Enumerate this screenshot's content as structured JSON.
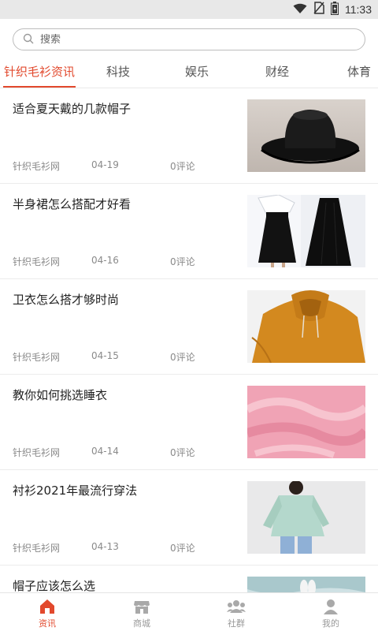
{
  "status_bar": {
    "time": "11:33"
  },
  "search": {
    "placeholder": "搜索"
  },
  "tabs": [
    {
      "label": "针织毛衫资讯",
      "active": true
    },
    {
      "label": "科技"
    },
    {
      "label": "娱乐"
    },
    {
      "label": "财经"
    },
    {
      "label": "体育"
    }
  ],
  "news": [
    {
      "title": " 适合夏天戴的几款帽子",
      "source": "针织毛衫网",
      "date": "04-19",
      "comments": "0评论",
      "thumb": "black-hat-photo"
    },
    {
      "title": "半身裙怎么搭配才好看",
      "source": "针织毛衫网",
      "date": "04-16",
      "comments": "0评论",
      "thumb": "black-skirts-photo"
    },
    {
      "title": "卫衣怎么搭才够时尚",
      "source": "针织毛衫网",
      "date": "04-15",
      "comments": "0评论",
      "thumb": "orange-hoodie-photo"
    },
    {
      "title": "教你如何挑选睡衣",
      "source": "针织毛衫网",
      "date": "04-14",
      "comments": "0评论",
      "thumb": "pink-fleece-photo"
    },
    {
      "title": "衬衫2021年最流行穿法",
      "source": "针织毛衫网",
      "date": "04-13",
      "comments": "0评论",
      "thumb": "mint-shirt-photo"
    },
    {
      "title": "帽子应该怎么选",
      "thumb": "bunny-photo"
    }
  ],
  "bottom_nav": [
    {
      "label": "资讯",
      "icon": "home-icon",
      "active": true
    },
    {
      "label": "商城",
      "icon": "store-icon"
    },
    {
      "label": "社群",
      "icon": "community-icon"
    },
    {
      "label": "我的",
      "icon": "user-icon"
    }
  ],
  "colors": {
    "accent": "#e2492d",
    "muted": "#999999"
  }
}
